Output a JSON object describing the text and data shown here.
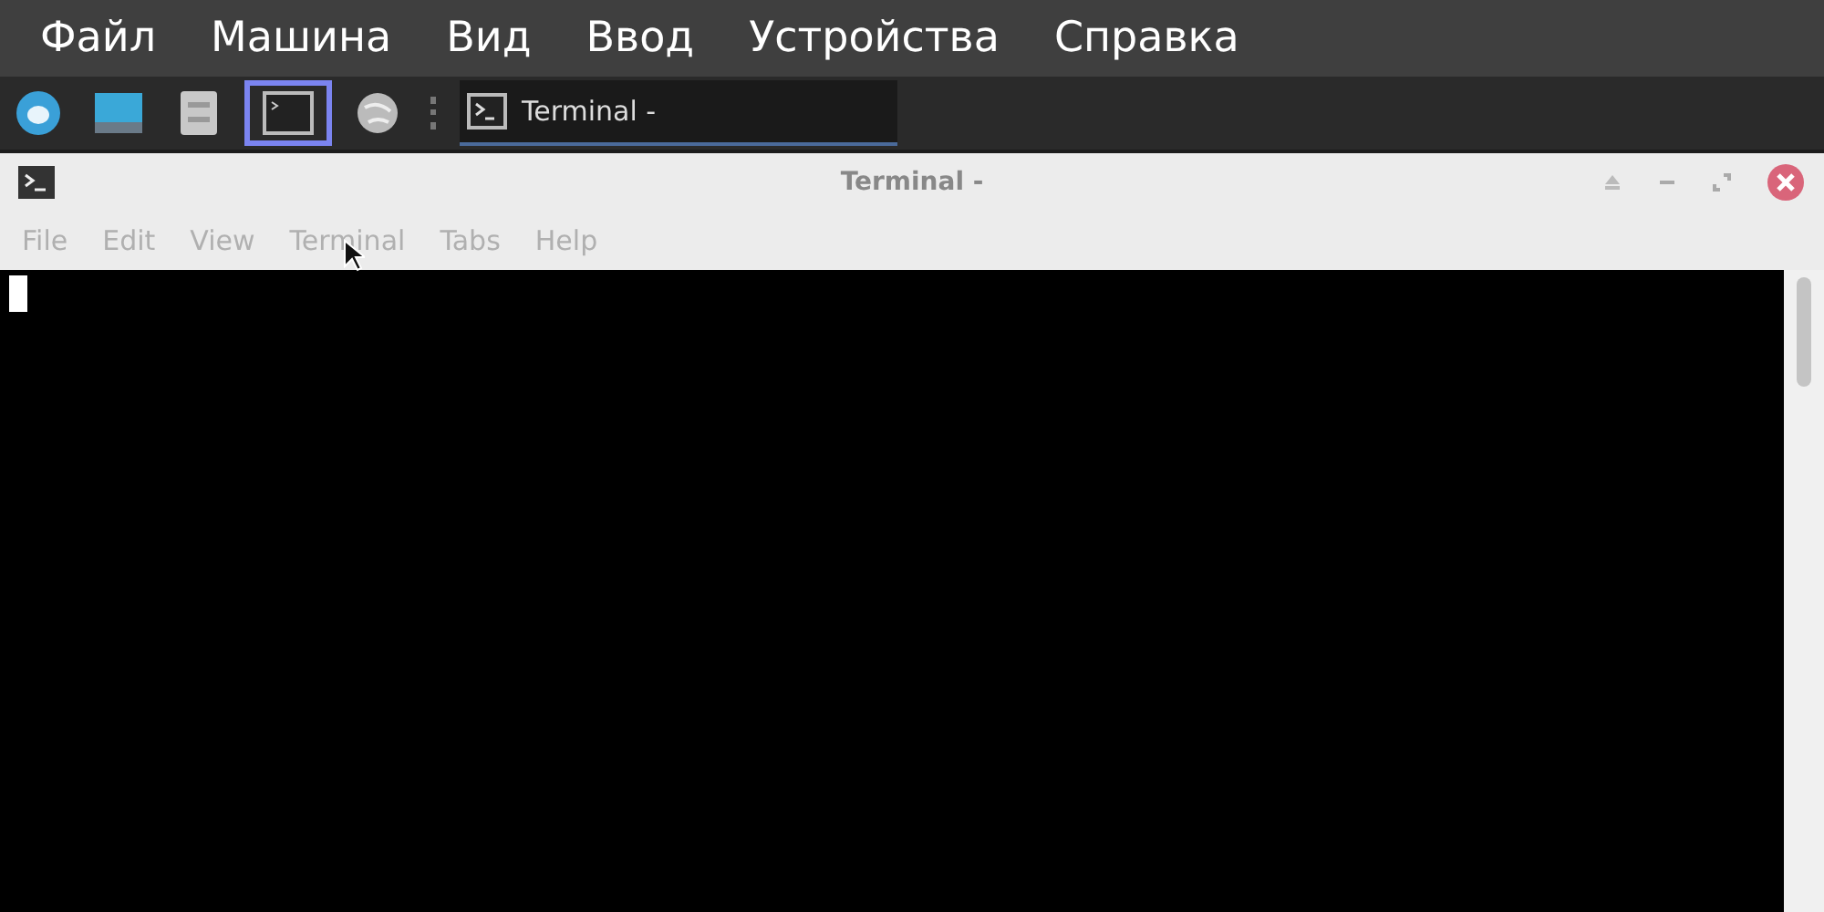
{
  "host_menu": [
    "Файл",
    "Машина",
    "Вид",
    "Ввод",
    "Устройства",
    "Справка"
  ],
  "launchers": [
    {
      "kind": "app",
      "selected": false
    },
    {
      "kind": "desktop",
      "selected": false
    },
    {
      "kind": "files",
      "selected": false
    },
    {
      "kind": "terminal",
      "selected": true
    },
    {
      "kind": "browser",
      "selected": false
    }
  ],
  "taskbar": [
    {
      "label": "Terminal -"
    }
  ],
  "window": {
    "title": "Terminal -",
    "menu": [
      "File",
      "Edit",
      "View",
      "Terminal",
      "Tabs",
      "Help"
    ]
  }
}
